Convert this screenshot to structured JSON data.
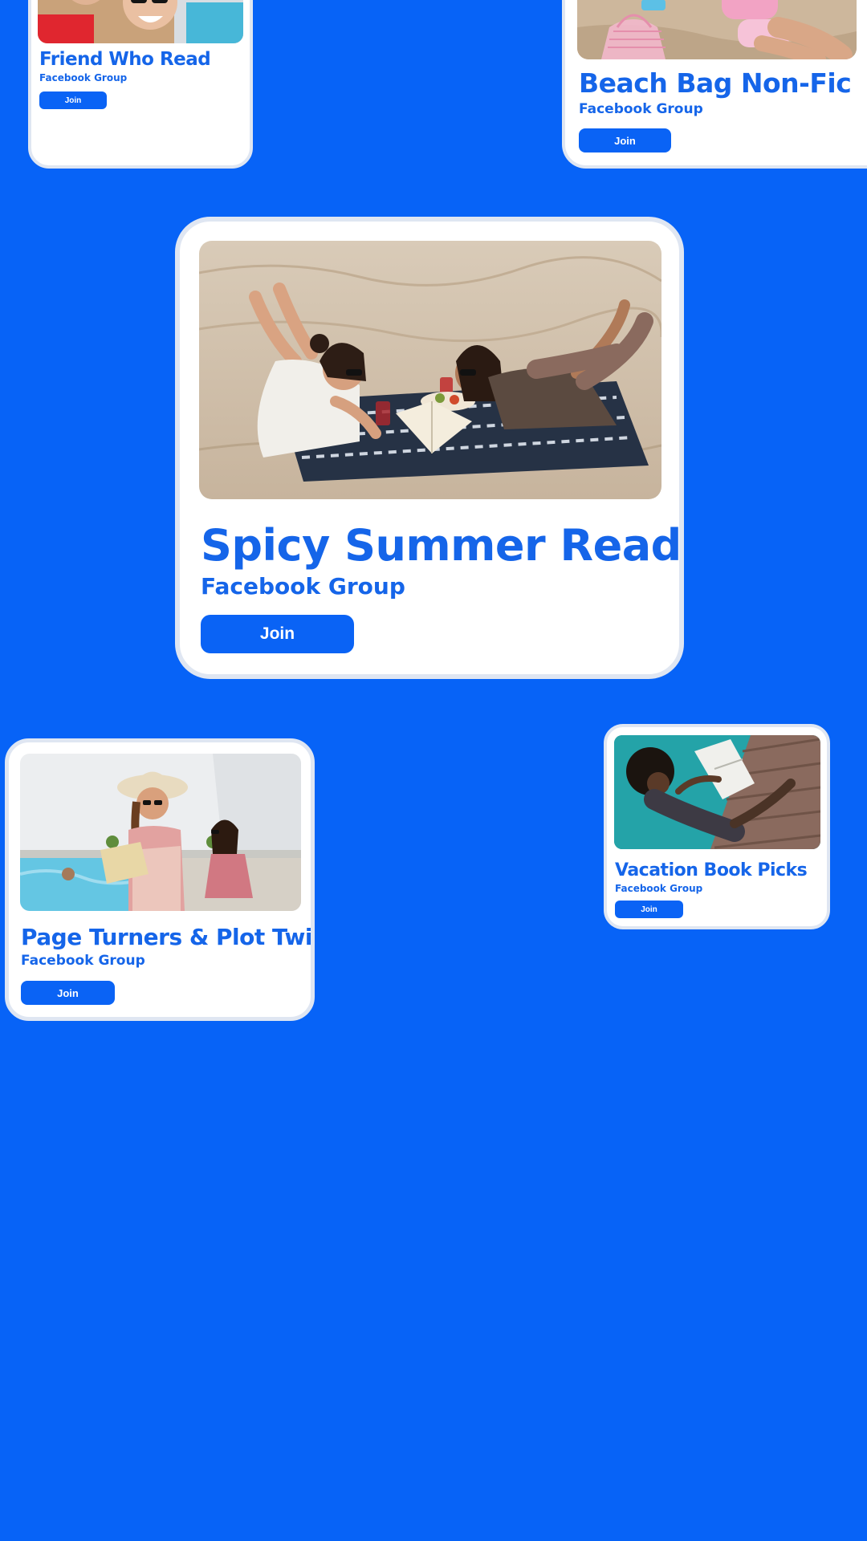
{
  "colors": {
    "background": "#0763f7",
    "card": "#ffffff",
    "card_border": "#dfe6f2",
    "title_text": "#1565e9",
    "button": "#0a63f5",
    "button_text": "#ffffff"
  },
  "cards": [
    {
      "id": "friend",
      "title": "Friend Who Read",
      "subtitle": "Facebook Group",
      "join_label": "Join",
      "photo": "photo of friends laughing with sunglasses"
    },
    {
      "id": "beach",
      "title": "Beach Bag Non-Fic",
      "subtitle": "Facebook Group",
      "join_label": "Join",
      "photo": "photo of person on sand with pink mesh beach bag"
    },
    {
      "id": "spicy",
      "title": "Spicy Summer Reads",
      "subtitle": "Facebook Group",
      "join_label": "Join",
      "photo": "photo of two women lying on beach blanket reading"
    },
    {
      "id": "page",
      "title": "Page Turners & Plot Twists",
      "subtitle": "Facebook Group",
      "join_label": "Join",
      "photo": "photo of woman in sun hat reading by pool"
    },
    {
      "id": "vacation",
      "title": "Vacation Book Picks",
      "subtitle": "Facebook Group",
      "join_label": "Join",
      "photo": "photo of person reading book by pool deck"
    }
  ]
}
